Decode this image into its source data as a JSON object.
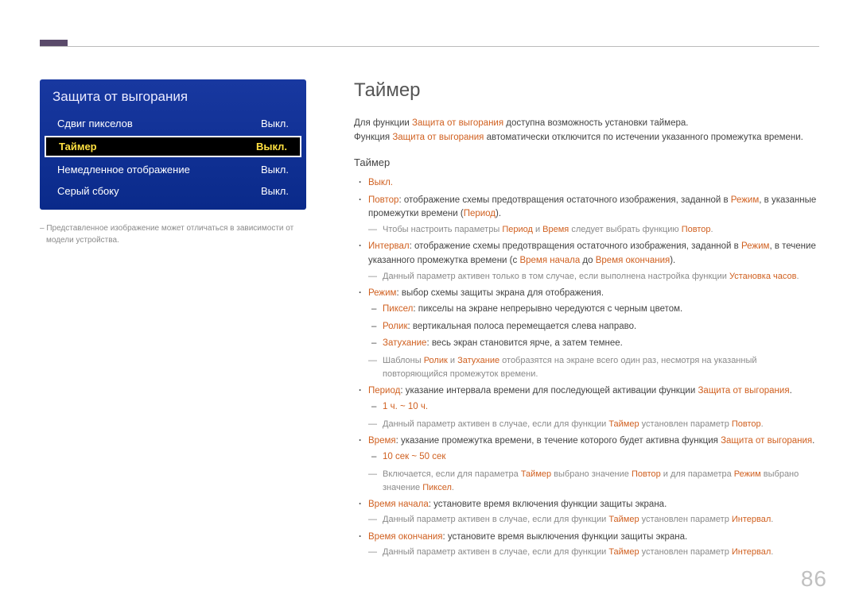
{
  "pageNumber": "86",
  "osd": {
    "title": "Защита от выгорания",
    "rows": [
      {
        "label": "Сдвиг пикселов",
        "value": "Выкл."
      },
      {
        "label": "Таймер",
        "value": "Выкл."
      },
      {
        "label": "Немедленное отображение",
        "value": "Выкл."
      },
      {
        "label": "Серый сбоку",
        "value": "Выкл."
      }
    ],
    "caption": "Представленное изображение может отличаться в зависимости от модели устройства."
  },
  "main": {
    "title": "Таймер",
    "intro1_a": "Для функции ",
    "intro1_b": "Защита от выгорания",
    "intro1_c": " доступна возможность установки таймера.",
    "intro2_a": "Функция ",
    "intro2_b": "Защита от выгорания",
    "intro2_c": " автоматически отключится по истечении указанного промежутка времени.",
    "subTitle": "Таймер",
    "li_off": "Выкл.",
    "li_repeat_a": "Повтор",
    "li_repeat_b": ": отображение схемы предотвращения остаточного изображения, заданной в ",
    "li_repeat_c": "Режим",
    "li_repeat_d": ", в указанные промежутки времени (",
    "li_repeat_e": "Период",
    "li_repeat_f": ").",
    "note_repeat_a": "Чтобы настроить параметры ",
    "note_repeat_b": "Период",
    "note_repeat_c": " и ",
    "note_repeat_d": "Время",
    "note_repeat_e": " следует выбрать функцию ",
    "note_repeat_f": "Повтор",
    "note_repeat_g": ".",
    "li_interval_a": "Интервал",
    "li_interval_b": ": отображение схемы предотвращения остаточного изображения, заданной в ",
    "li_interval_c": "Режим",
    "li_interval_d": ", в течение указанного промежутка времени (с ",
    "li_interval_e": "Время начала",
    "li_interval_f": " до ",
    "li_interval_g": "Время окончания",
    "li_interval_h": ").",
    "note_interval_a": "Данный параметр активен только в том случае, если выполнена настройка функции ",
    "note_interval_b": "Установка часов",
    "note_interval_c": ".",
    "li_mode_a": "Режим",
    "li_mode_b": ": выбор схемы защиты экрана для отображения.",
    "sub_pixel_a": "Пиксел",
    "sub_pixel_b": ": пикселы на экране непрерывно чередуются с черным цветом.",
    "sub_roll_a": "Ролик",
    "sub_roll_b": ": вертикальная полоса перемещается слева направо.",
    "sub_fade_a": "Затухание",
    "sub_fade_b": ": весь экран становится ярче, а затем темнее.",
    "note_mode_a": "Шаблоны ",
    "note_mode_b": "Ролик",
    "note_mode_c": " и ",
    "note_mode_d": "Затухание",
    "note_mode_e": " отобразятся на экране всего один раз, несмотря на указанный повторяющийся промежуток времени.",
    "li_period_a": "Период",
    "li_period_b": ": указание интервала времени для последующей активации функции ",
    "li_period_c": "Защита от выгорания",
    "li_period_d": ".",
    "sub_period_range": "1 ч. ~ 10 ч.",
    "note_period_a": "Данный параметр активен в случае, если для функции ",
    "note_period_b": "Таймер",
    "note_period_c": " установлен параметр ",
    "note_period_d": "Повтор",
    "note_period_e": ".",
    "li_time_a": "Время",
    "li_time_b": ": указание промежутка времени, в течение которого будет активна функция ",
    "li_time_c": "Защита от выгорания",
    "li_time_d": ".",
    "sub_time_range": "10 сек ~ 50 сек",
    "note_time_a": "Включается, если для параметра ",
    "note_time_b": "Таймер",
    "note_time_c": " выбрано значение ",
    "note_time_d": "Повтор",
    "note_time_e": " и для параметра ",
    "note_time_f": "Режим",
    "note_time_g": " выбрано значение ",
    "note_time_h": "Пиксел",
    "note_time_i": ".",
    "li_start_a": "Время начала",
    "li_start_b": ": установите время включения функции защиты экрана.",
    "note_start_a": "Данный параметр активен в случае, если для функции ",
    "note_start_b": "Таймер",
    "note_start_c": " установлен параметр ",
    "note_start_d": "Интервал",
    "note_start_e": ".",
    "li_end_a": "Время окончания",
    "li_end_b": ": установите время выключения функции защиты экрана.",
    "note_end_a": "Данный параметр активен в случае, если для функции ",
    "note_end_b": "Таймер",
    "note_end_c": " установлен параметр ",
    "note_end_d": "Интервал",
    "note_end_e": "."
  }
}
